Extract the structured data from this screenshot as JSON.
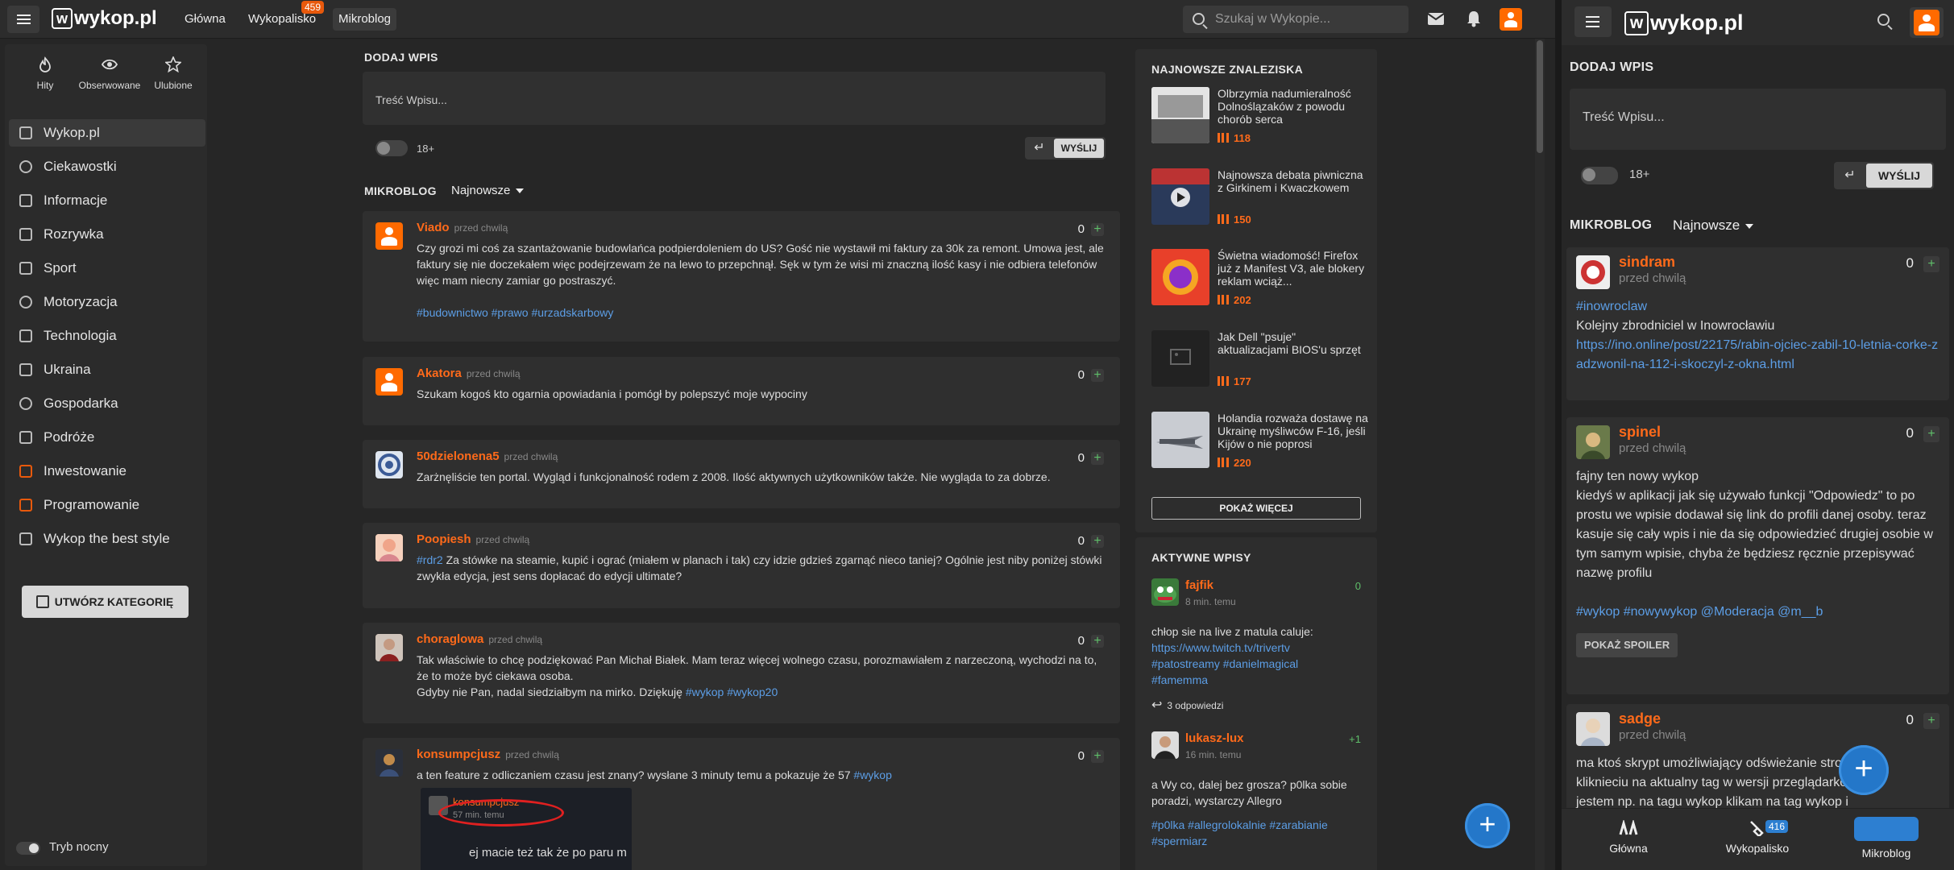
{
  "topbar": {
    "logo_text": "wykop.pl",
    "logo_letter": "w",
    "nav": [
      {
        "label": "Główna"
      },
      {
        "label": "Wykopalisko",
        "badge": "459"
      },
      {
        "label": "Mikroblog"
      }
    ],
    "search_placeholder": "Szukaj w Wykopie..."
  },
  "sidebar": {
    "quick": [
      {
        "label": "Hity",
        "icon": "flame-icon"
      },
      {
        "label": "Obserwowane",
        "icon": "eye-icon"
      },
      {
        "label": "Ulubione",
        "icon": "star-icon"
      }
    ],
    "items": [
      {
        "label": "Wykop.pl",
        "icon": "home-icon"
      },
      {
        "label": "Ciekawostki",
        "icon": "lightbulb-icon"
      },
      {
        "label": "Informacje",
        "icon": "news-icon"
      },
      {
        "label": "Rozrywka",
        "icon": "gamepad-icon"
      },
      {
        "label": "Sport",
        "icon": "sport-icon"
      },
      {
        "label": "Motoryzacja",
        "icon": "wheel-icon"
      },
      {
        "label": "Technologia",
        "icon": "chip-icon"
      },
      {
        "label": "Ukraina",
        "icon": "ukraine-icon"
      },
      {
        "label": "Gospodarka",
        "icon": "globe-icon"
      },
      {
        "label": "Podróże",
        "icon": "luggage-icon"
      },
      {
        "label": "Inwestowanie",
        "icon": "chart-icon"
      },
      {
        "label": "Programowanie",
        "icon": "code-icon"
      },
      {
        "label": "Wykop the best style",
        "icon": "list-icon"
      }
    ],
    "create_category": "UTWÓRZ KATEGORIĘ",
    "night_mode": "Tryb nocny"
  },
  "compose": {
    "title": "DODAJ WPIS",
    "placeholder": "Treść Wpisu...",
    "adult_label": "18+",
    "send": "WYŚLIJ"
  },
  "microblog": {
    "title": "MIKROBLOG",
    "sort": "Najnowsze",
    "posts": [
      {
        "author": "Viado",
        "time": "przed chwilą",
        "votes": "0",
        "text": "Czy grozi mi coś za szantażowanie budowlańca podpierdoleniem do US? Gość nie wystawił mi faktury za 30k za remont. Umowa jest, ale faktury się nie doczekałem więc podejrzewam że na lewo to przepchnął. Sęk w tym że wisi mi znaczną ilość kasy i nie odbiera telefonów więc mam niecny zamiar go postraszyć.",
        "tags": [
          "#budownictwo",
          "#prawo",
          "#urzadskarbowy"
        ]
      },
      {
        "author": "Akatora",
        "time": "przed chwilą",
        "votes": "0",
        "text": "Szukam kogoś kto ogarnia opowiadania i pomógł by polepszyć moje wypociny"
      },
      {
        "author": "50dzielonena5",
        "time": "przed chwilą",
        "votes": "0",
        "text": "Zarżnęliście ten portal. Wygląd i funkcjonalność rodem z 2008. Ilość aktywnych użytkowników także. Nie wygląda to za dobrze."
      },
      {
        "author": "Poopiesh",
        "time": "przed chwilą",
        "votes": "0",
        "tag_lead": "#rdr2",
        "text": " Za stówke na steamie, kupić i ograć (miałem w planach i tak) czy idzie gdzieś zgarnąć nieco taniej? Ogólnie jest niby poniżej stówki zwykła edycja, jest sens dopłacać do edycji ultimate?"
      },
      {
        "author": "choraglowa",
        "time": "przed chwilą",
        "votes": "0",
        "text": "Tak właściwie to chcę podziękować Pan Michał Białek. Mam teraz więcej wolnego czasu, porozmawiałem z narzeczoną, wychodzi na to, że to może być ciekawa osoba.",
        "text2": "Gdyby nie Pan, nadal siedziałbym na mirko. Dziękuję ",
        "tags": [
          "#wykop",
          "#wykop20"
        ]
      },
      {
        "author": "konsumpcjusz",
        "time": "przed chwilą",
        "votes": "0",
        "text": "a ten feature z odliczaniem czasu jest znany? wysłane 3 minuty temu a pokazuje że 57 ",
        "tags": [
          "#wykop"
        ],
        "embed": {
          "author": "konsumpcjusz",
          "time": "57 min. temu",
          "text": "ej macie też tak że po paru m"
        }
      }
    ]
  },
  "findings": {
    "title": "NAJNOWSZE ZNALEZISKA",
    "items": [
      {
        "title": "Olbrzymia nadumieralność Dolnoślązaków z powodu chorób serca",
        "votes": "118"
      },
      {
        "title": "Najnowsza debata piwniczna z Girkinem i Kwaczkowem",
        "votes": "150"
      },
      {
        "title": "Świetna wiadomość! Firefox już z Manifest V3, ale blokery reklam wciąż...",
        "votes": "202"
      },
      {
        "title": "Jak Dell \"psuje\" aktualizacjami BIOS'u sprzęt",
        "votes": "177"
      },
      {
        "title": "Holandia rozważa dostawę na Ukrainę myśliwców F-16, jeśli Kijów o nie poprosi",
        "votes": "220"
      }
    ],
    "more": "POKAŻ WIĘCEJ"
  },
  "active": {
    "title": "AKTYWNE WPISY",
    "items": [
      {
        "author": "fajfik",
        "time": "8 min. temu",
        "votes": "0",
        "text": "chłop sie na live z matula caluje:",
        "link": "https://www.twitch.tv/trivertv",
        "tags": [
          "#patostreamy",
          "#danielmagical",
          "#famemma"
        ],
        "replies": "3 odpowiedzi"
      },
      {
        "author": "lukasz-lux",
        "time": "16 min. temu",
        "votes": "+1",
        "text": "a Wy co, dalej bez grosza? p0lka sobie poradzi, wystarczy Allegro",
        "tags": [
          "#p0lka",
          "#allegrolokalnie",
          "#zarabianie",
          "#spermiarz"
        ]
      }
    ]
  },
  "mobile": {
    "logo_text": "wykop.pl",
    "compose_title": "DODAJ WPIS",
    "placeholder": "Treść Wpisu...",
    "adult_label": "18+",
    "send": "WYŚLIJ",
    "mikro_title": "MIKROBLOG",
    "sort": "Najnowsze",
    "posts": [
      {
        "author": "sindram",
        "time": "przed chwilą",
        "votes": "0",
        "tag": "#inowroclaw",
        "text": "Kolejny zbrodniciel w Inowrocławiu",
        "link": "https://ino.online/post/22175/rabin-ojciec-zabil-10-letnia-corke-zadzwonil-na-112-i-skoczyl-z-okna.html"
      },
      {
        "author": "spinel",
        "time": "przed chwilą",
        "votes": "0",
        "text": "fajny ten nowy wykop",
        "text2": "kiedyś w aplikacji jak się używało funkcji \"Odpowiedz\" to po prostu we wpisie dodawał się link do profili danej osoby. teraz kasuje się cały wpis i nie da się odpowiedzieć drugiej osobie w tym samym wpisie, chyba że będziesz ręcznie przepisywać nazwę profilu",
        "tags": [
          "#wykop",
          "#nowywykop",
          "@Moderacja",
          "@m__b"
        ],
        "spoiler": "POKAŻ SPOILER"
      },
      {
        "author": "sadge",
        "time": "przed chwilą",
        "votes": "0",
        "text": "ma ktoś skrypt umożliwiający odświeżanie strony po kliknieciu na aktualny tag w wersji przeglądarkowej? jestem np. na tagu wykop klikam na tag wykop i odświeża mi stronę"
      }
    ],
    "bottom_nav": [
      {
        "label": "Główna"
      },
      {
        "label": "Wykopalisko",
        "badge": "416"
      },
      {
        "label": "Mikroblog"
      }
    ]
  },
  "colors": {
    "accent": "#ff6a1a",
    "link": "#5c9ee6",
    "fab": "#2477c9"
  }
}
